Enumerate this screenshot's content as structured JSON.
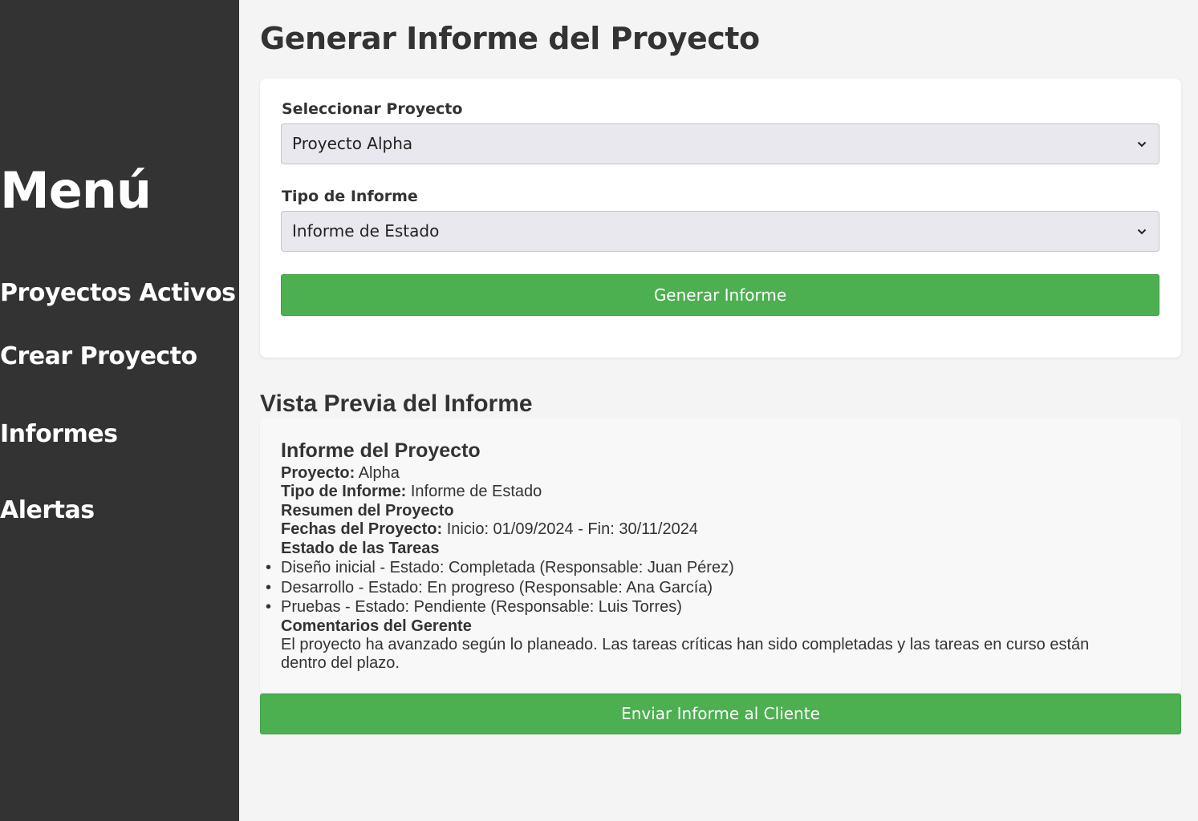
{
  "sidebar": {
    "title": "Menú",
    "items": [
      {
        "label": "Proyectos Activos"
      },
      {
        "label": "Crear Proyecto"
      },
      {
        "label": "Informes"
      },
      {
        "label": "Alertas"
      }
    ]
  },
  "page_title": "Generar Informe del Proyecto",
  "form": {
    "project_label": "Seleccionar Proyecto",
    "project_value": "Proyecto Alpha",
    "report_type_label": "Tipo de Informe",
    "report_type_value": "Informe de Estado",
    "generate_button": "Generar Informe"
  },
  "preview": {
    "section_title": "Vista Previa del Informe",
    "heading": "Informe del Proyecto",
    "project_key": "Proyecto:",
    "project_value": "Alpha",
    "type_key": "Tipo de Informe:",
    "type_value": "Informe de Estado",
    "summary_heading": "Resumen del Proyecto",
    "dates_key": "Fechas del Proyecto:",
    "dates_value": "Inicio: 01/09/2024 - Fin: 30/11/2024",
    "tasks_heading": "Estado de las Tareas",
    "tasks": [
      "Diseño inicial - Estado: Completada (Responsable: Juan Pérez)",
      "Desarrollo - Estado: En progreso (Responsable: Ana García)",
      "Pruebas - Estado: Pendiente (Responsable: Luis Torres)"
    ],
    "comments_heading": "Comentarios del Gerente",
    "comments": "El proyecto ha avanzado según lo planeado. Las tareas críticas han sido completadas y las tareas en curso están dentro del plazo."
  },
  "send_button": "Enviar Informe al Cliente",
  "colors": {
    "sidebar_bg": "#333333",
    "accent_green": "#4caf50",
    "page_bg": "#f4f4f4"
  },
  "icons": {
    "select_arrow": "chevron-down-icon"
  }
}
